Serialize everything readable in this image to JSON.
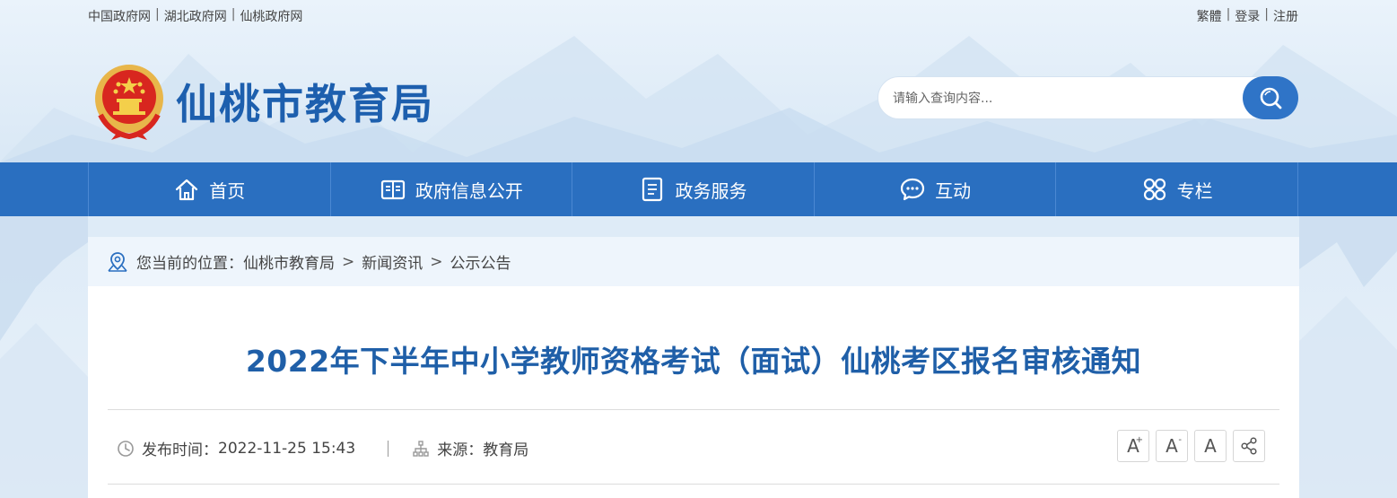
{
  "top_links": {
    "left": [
      "中国政府网",
      "湖北政府网",
      "仙桃政府网"
    ],
    "right": [
      "繁體",
      "登录",
      "注册"
    ],
    "separator": "|"
  },
  "header": {
    "site_title": "仙桃市教育局",
    "emblem_icon": "national-emblem-icon"
  },
  "search": {
    "placeholder": "请输入查询内容...",
    "value": "",
    "button_icon": "search-icon"
  },
  "nav": {
    "items": [
      {
        "label": "首页",
        "icon": "home-icon"
      },
      {
        "label": "政府信息公开",
        "icon": "book-icon"
      },
      {
        "label": "政务服务",
        "icon": "document-icon"
      },
      {
        "label": "互动",
        "icon": "chat-icon"
      },
      {
        "label": "专栏",
        "icon": "grid-icon"
      }
    ]
  },
  "breadcrumb": {
    "prefix": "您当前的位置：",
    "items": [
      "仙桃市教育局",
      "新闻资讯",
      "公示公告"
    ],
    "separator": ">"
  },
  "article": {
    "title": "2022年下半年中小学教师资格考试（面试）仙桃考区报名审核通知",
    "publish_label": "发布时间：",
    "publish_time": "2022-11-25 15:43",
    "source_label": "来源：",
    "source": "教育局"
  },
  "tools": {
    "font_larger": "A",
    "font_larger_mark": "+",
    "font_smaller": "A",
    "font_smaller_mark": "-",
    "font_default": "A",
    "share_icon": "share-icon"
  },
  "colors": {
    "brand_blue": "#2a6fc0",
    "title_blue": "#1f5fa8",
    "site_title_blue": "#1d5fae"
  }
}
